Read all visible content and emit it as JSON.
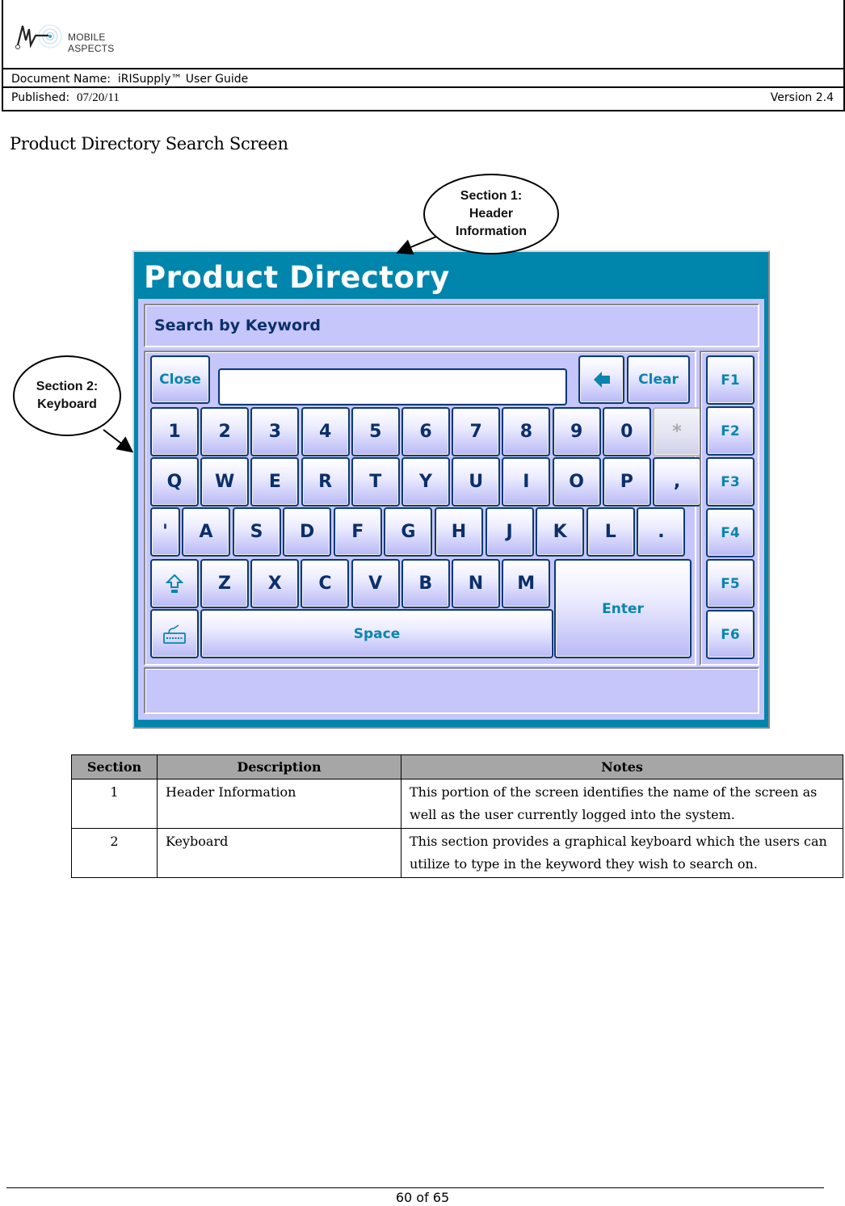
{
  "doc_header": {
    "logo_text": "MOBILE ASPECTS",
    "document_name_label": "Document Name:",
    "document_name": "iRISupply™ User Guide",
    "published_label": "Published:",
    "published_date": "07/20/11",
    "version": "Version 2.4"
  },
  "page_title": "Product Directory Search Screen",
  "callouts": [
    {
      "lines": [
        "Section 1:",
        "Header",
        "Information"
      ]
    },
    {
      "lines": [
        "Section 2:",
        "Keyboard"
      ]
    }
  ],
  "app": {
    "title": "Product Directory",
    "search_label": "Search by Keyword",
    "search_input": {
      "value": "",
      "placeholder": ""
    },
    "buttons": {
      "close": "Close",
      "backspace_icon": "left-arrow-icon",
      "clear": "Clear",
      "enter": "Enter",
      "space": "Space",
      "shift_icon": "shift-arrow-icon",
      "keyboard_icon": "keyboard-icon"
    },
    "rows": {
      "numbers": [
        "1",
        "2",
        "3",
        "4",
        "5",
        "6",
        "7",
        "8",
        "9",
        "0",
        "*"
      ],
      "qwerty": [
        "Q",
        "W",
        "E",
        "R",
        "T",
        "Y",
        "U",
        "I",
        "O",
        "P",
        ","
      ],
      "asdf": [
        "'",
        "A",
        "S",
        "D",
        "F",
        "G",
        "H",
        "J",
        "K",
        "L",
        "."
      ],
      "zxcv": [
        "Z",
        "X",
        "C",
        "V",
        "B",
        "N",
        "M"
      ]
    },
    "disabled_keys": [
      "*"
    ],
    "function_keys": [
      "F1",
      "F2",
      "F3",
      "F4",
      "F5",
      "F6"
    ],
    "colors": {
      "header_teal": "#0085ad",
      "panel_lavender": "#c6c6fb",
      "key_text_navy": "#0a2f6b",
      "key_text_teal": "#0a85ad"
    }
  },
  "table": {
    "headers": [
      "Section",
      "Description",
      "Notes"
    ],
    "rows": [
      {
        "section": "1",
        "description": "Header Information",
        "notes": "This portion of the screen identifies the name of the screen as well as the user currently logged into the system."
      },
      {
        "section": "2",
        "description": "Keyboard",
        "notes": "This section provides a graphical keyboard which the users can utilize to type in the keyword they wish to search on."
      }
    ]
  },
  "footer": {
    "page": "60 of 65"
  }
}
